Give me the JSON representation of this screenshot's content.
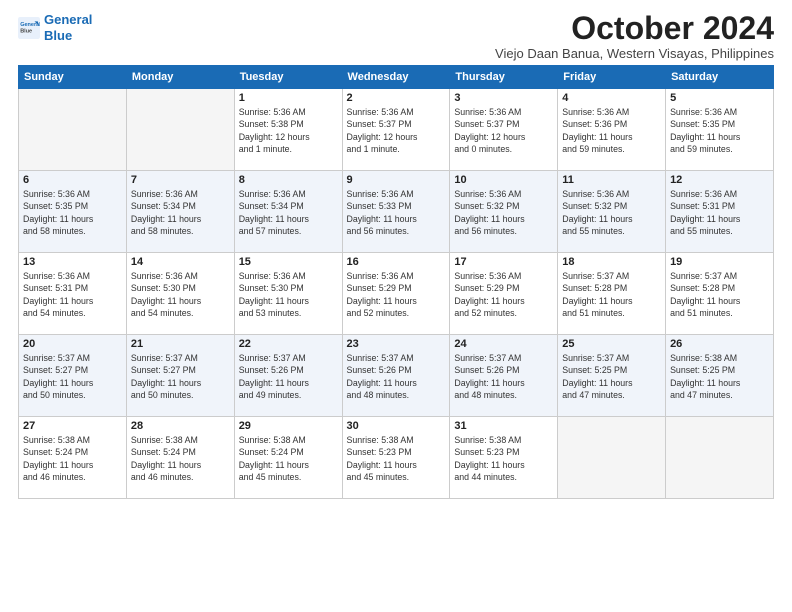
{
  "logo": {
    "line1": "General",
    "line2": "Blue"
  },
  "title": "October 2024",
  "subtitle": "Viejo Daan Banua, Western Visayas, Philippines",
  "weekdays": [
    "Sunday",
    "Monday",
    "Tuesday",
    "Wednesday",
    "Thursday",
    "Friday",
    "Saturday"
  ],
  "weeks": [
    [
      {
        "day": "",
        "info": ""
      },
      {
        "day": "",
        "info": ""
      },
      {
        "day": "1",
        "info": "Sunrise: 5:36 AM\nSunset: 5:38 PM\nDaylight: 12 hours\nand 1 minute."
      },
      {
        "day": "2",
        "info": "Sunrise: 5:36 AM\nSunset: 5:37 PM\nDaylight: 12 hours\nand 1 minute."
      },
      {
        "day": "3",
        "info": "Sunrise: 5:36 AM\nSunset: 5:37 PM\nDaylight: 12 hours\nand 0 minutes."
      },
      {
        "day": "4",
        "info": "Sunrise: 5:36 AM\nSunset: 5:36 PM\nDaylight: 11 hours\nand 59 minutes."
      },
      {
        "day": "5",
        "info": "Sunrise: 5:36 AM\nSunset: 5:35 PM\nDaylight: 11 hours\nand 59 minutes."
      }
    ],
    [
      {
        "day": "6",
        "info": "Sunrise: 5:36 AM\nSunset: 5:35 PM\nDaylight: 11 hours\nand 58 minutes."
      },
      {
        "day": "7",
        "info": "Sunrise: 5:36 AM\nSunset: 5:34 PM\nDaylight: 11 hours\nand 58 minutes."
      },
      {
        "day": "8",
        "info": "Sunrise: 5:36 AM\nSunset: 5:34 PM\nDaylight: 11 hours\nand 57 minutes."
      },
      {
        "day": "9",
        "info": "Sunrise: 5:36 AM\nSunset: 5:33 PM\nDaylight: 11 hours\nand 56 minutes."
      },
      {
        "day": "10",
        "info": "Sunrise: 5:36 AM\nSunset: 5:32 PM\nDaylight: 11 hours\nand 56 minutes."
      },
      {
        "day": "11",
        "info": "Sunrise: 5:36 AM\nSunset: 5:32 PM\nDaylight: 11 hours\nand 55 minutes."
      },
      {
        "day": "12",
        "info": "Sunrise: 5:36 AM\nSunset: 5:31 PM\nDaylight: 11 hours\nand 55 minutes."
      }
    ],
    [
      {
        "day": "13",
        "info": "Sunrise: 5:36 AM\nSunset: 5:31 PM\nDaylight: 11 hours\nand 54 minutes."
      },
      {
        "day": "14",
        "info": "Sunrise: 5:36 AM\nSunset: 5:30 PM\nDaylight: 11 hours\nand 54 minutes."
      },
      {
        "day": "15",
        "info": "Sunrise: 5:36 AM\nSunset: 5:30 PM\nDaylight: 11 hours\nand 53 minutes."
      },
      {
        "day": "16",
        "info": "Sunrise: 5:36 AM\nSunset: 5:29 PM\nDaylight: 11 hours\nand 52 minutes."
      },
      {
        "day": "17",
        "info": "Sunrise: 5:36 AM\nSunset: 5:29 PM\nDaylight: 11 hours\nand 52 minutes."
      },
      {
        "day": "18",
        "info": "Sunrise: 5:37 AM\nSunset: 5:28 PM\nDaylight: 11 hours\nand 51 minutes."
      },
      {
        "day": "19",
        "info": "Sunrise: 5:37 AM\nSunset: 5:28 PM\nDaylight: 11 hours\nand 51 minutes."
      }
    ],
    [
      {
        "day": "20",
        "info": "Sunrise: 5:37 AM\nSunset: 5:27 PM\nDaylight: 11 hours\nand 50 minutes."
      },
      {
        "day": "21",
        "info": "Sunrise: 5:37 AM\nSunset: 5:27 PM\nDaylight: 11 hours\nand 50 minutes."
      },
      {
        "day": "22",
        "info": "Sunrise: 5:37 AM\nSunset: 5:26 PM\nDaylight: 11 hours\nand 49 minutes."
      },
      {
        "day": "23",
        "info": "Sunrise: 5:37 AM\nSunset: 5:26 PM\nDaylight: 11 hours\nand 48 minutes."
      },
      {
        "day": "24",
        "info": "Sunrise: 5:37 AM\nSunset: 5:26 PM\nDaylight: 11 hours\nand 48 minutes."
      },
      {
        "day": "25",
        "info": "Sunrise: 5:37 AM\nSunset: 5:25 PM\nDaylight: 11 hours\nand 47 minutes."
      },
      {
        "day": "26",
        "info": "Sunrise: 5:38 AM\nSunset: 5:25 PM\nDaylight: 11 hours\nand 47 minutes."
      }
    ],
    [
      {
        "day": "27",
        "info": "Sunrise: 5:38 AM\nSunset: 5:24 PM\nDaylight: 11 hours\nand 46 minutes."
      },
      {
        "day": "28",
        "info": "Sunrise: 5:38 AM\nSunset: 5:24 PM\nDaylight: 11 hours\nand 46 minutes."
      },
      {
        "day": "29",
        "info": "Sunrise: 5:38 AM\nSunset: 5:24 PM\nDaylight: 11 hours\nand 45 minutes."
      },
      {
        "day": "30",
        "info": "Sunrise: 5:38 AM\nSunset: 5:23 PM\nDaylight: 11 hours\nand 45 minutes."
      },
      {
        "day": "31",
        "info": "Sunrise: 5:38 AM\nSunset: 5:23 PM\nDaylight: 11 hours\nand 44 minutes."
      },
      {
        "day": "",
        "info": ""
      },
      {
        "day": "",
        "info": ""
      }
    ]
  ]
}
